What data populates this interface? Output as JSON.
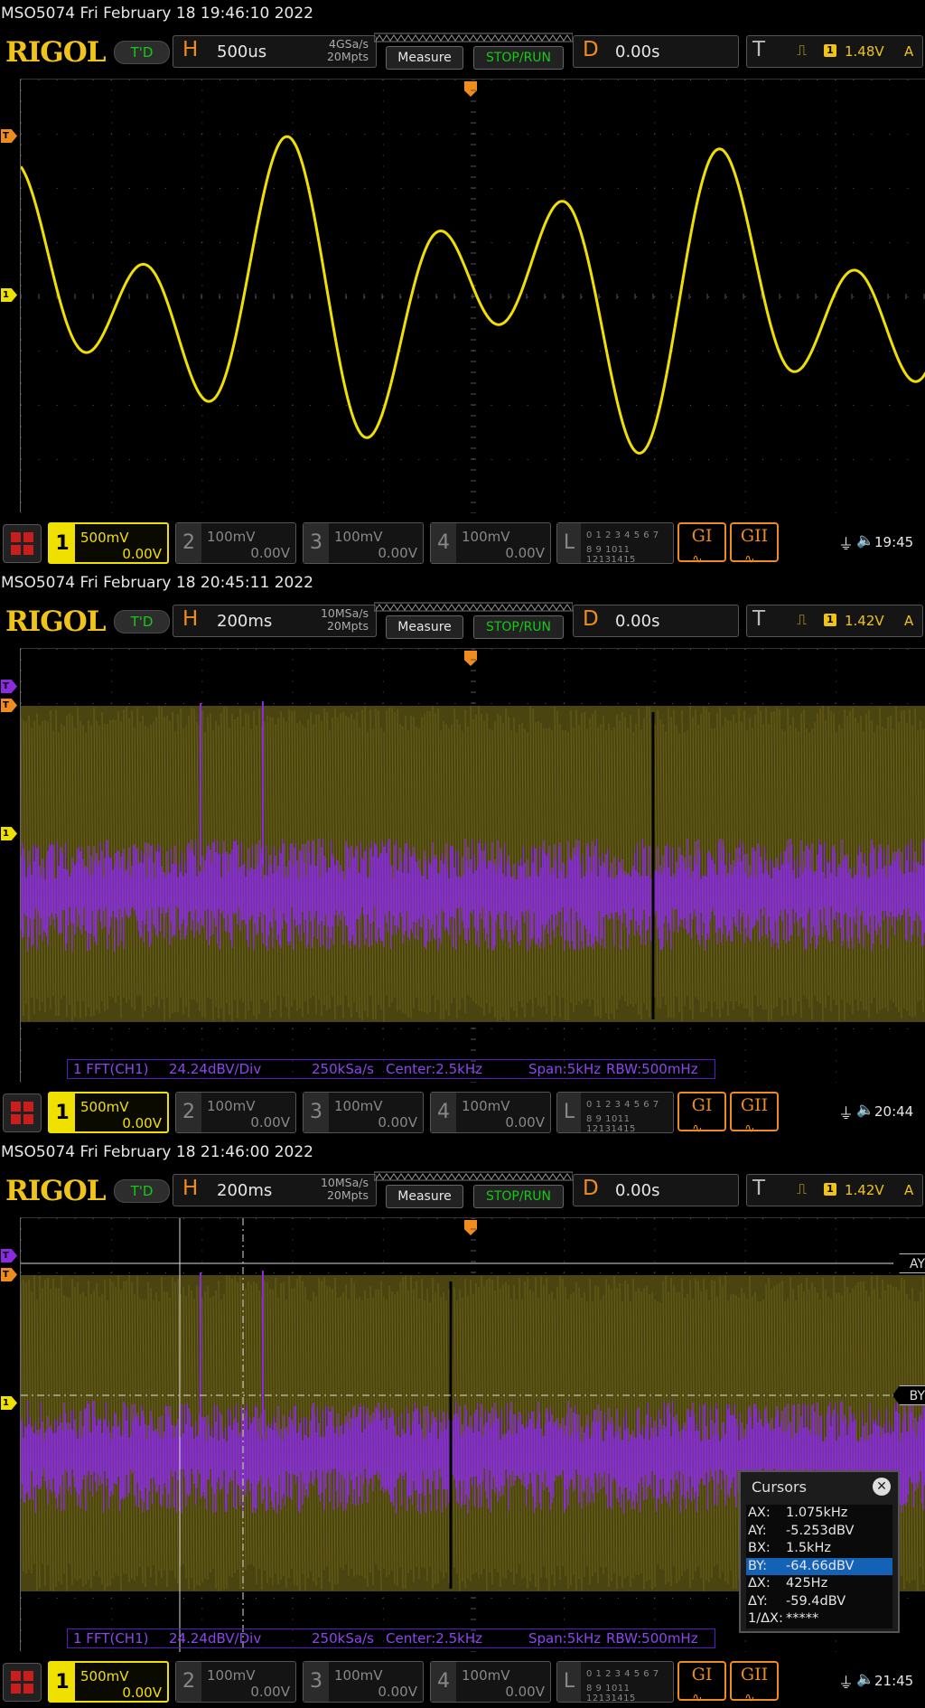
{
  "screens": [
    {
      "caption": "MSO5074  Fri February 18 19:46:10 2022",
      "horizontal": {
        "letter": "H",
        "timebase": "500us",
        "sample_rate": "4GSa/s",
        "memory": "20Mpts"
      },
      "buttons": {
        "measure": "Measure",
        "stop_run": "STOP/RUN"
      },
      "delay": {
        "letter": "D",
        "value": "0.00s"
      },
      "trigger": {
        "letter": "T",
        "source": "1",
        "level": "1.48V",
        "mode": "A"
      },
      "ch1": {
        "num": "1",
        "scale": "500mV",
        "offset": "0.00V"
      },
      "ch2": {
        "num": "2",
        "scale": "100mV",
        "offset": "0.00V"
      },
      "ch3": {
        "num": "3",
        "scale": "100mV",
        "offset": "0.00V"
      },
      "ch4": {
        "num": "4",
        "scale": "100mV",
        "offset": "0.00V"
      },
      "clock": "19:45"
    },
    {
      "caption": "MSO5074  Fri February 18 20:45:11 2022",
      "horizontal": {
        "letter": "H",
        "timebase": "200ms",
        "sample_rate": "10MSa/s",
        "memory": "20Mpts"
      },
      "buttons": {
        "measure": "Measure",
        "stop_run": "STOP/RUN"
      },
      "delay": {
        "letter": "D",
        "value": "0.00s"
      },
      "trigger": {
        "letter": "T",
        "source": "1",
        "level": "1.42V",
        "mode": "A"
      },
      "ch1": {
        "num": "1",
        "scale": "500mV",
        "offset": "0.00V"
      },
      "ch2": {
        "num": "2",
        "scale": "100mV",
        "offset": "0.00V"
      },
      "ch3": {
        "num": "3",
        "scale": "100mV",
        "offset": "0.00V"
      },
      "ch4": {
        "num": "4",
        "scale": "100mV",
        "offset": "0.00V"
      },
      "fft": {
        "label": "1 FFT(CH1)",
        "scale": "24.24dBV/Div",
        "rate": "250kSa/s",
        "center": "Center:2.5kHz",
        "span": "Span:5kHz",
        "rbw": "RBW:500mHz"
      },
      "clock": "20:44"
    },
    {
      "caption": "MSO5074  Fri February 18 21:46:00 2022",
      "horizontal": {
        "letter": "H",
        "timebase": "200ms",
        "sample_rate": "10MSa/s",
        "memory": "20Mpts"
      },
      "buttons": {
        "measure": "Measure",
        "stop_run": "STOP/RUN"
      },
      "delay": {
        "letter": "D",
        "value": "0.00s"
      },
      "trigger": {
        "letter": "T",
        "source": "1",
        "level": "1.42V",
        "mode": "A"
      },
      "ch1": {
        "num": "1",
        "scale": "500mV",
        "offset": "0.00V"
      },
      "ch2": {
        "num": "2",
        "scale": "100mV",
        "offset": "0.00V"
      },
      "ch3": {
        "num": "3",
        "scale": "100mV",
        "offset": "0.00V"
      },
      "ch4": {
        "num": "4",
        "scale": "100mV",
        "offset": "0.00V"
      },
      "fft": {
        "label": "1 FFT(CH1)",
        "scale": "24.24dBV/Div",
        "rate": "250kSa/s",
        "center": "Center:2.5kHz",
        "span": "Span:5kHz",
        "rbw": "RBW:500mHz"
      },
      "cursor_labels": {
        "ay": "AY",
        "by": "BY"
      },
      "clock": "21:45"
    }
  ],
  "common": {
    "logo": "RIGOL",
    "td": "T'D",
    "logic": {
      "num": "L",
      "digits_top": "0 1 2 3  4 5 6 7",
      "digits_bottom": "8 9 1011 12131415"
    },
    "g1": "GI",
    "g2": "GII",
    "marker_trigger": "T",
    "marker_ch1": "1"
  },
  "cursors": {
    "title": "Cursors",
    "rows": [
      {
        "k": "AX:",
        "v": "1.075kHz"
      },
      {
        "k": "AY:",
        "v": "-5.253dBV"
      },
      {
        "k": "BX:",
        "v": "1.5kHz"
      },
      {
        "k": "BY:",
        "v": "-64.66dBV",
        "selected": true
      },
      {
        "k": "ΔX:",
        "v": "425Hz"
      },
      {
        "k": "ΔY:",
        "v": "-59.4dBV"
      },
      {
        "k": "1/ΔX:",
        "v": "*****"
      }
    ]
  },
  "colors": {
    "ch1": "#f0e000",
    "fft": "#8a2be2",
    "accent": "#f08c1e",
    "green": "#17c917"
  }
}
